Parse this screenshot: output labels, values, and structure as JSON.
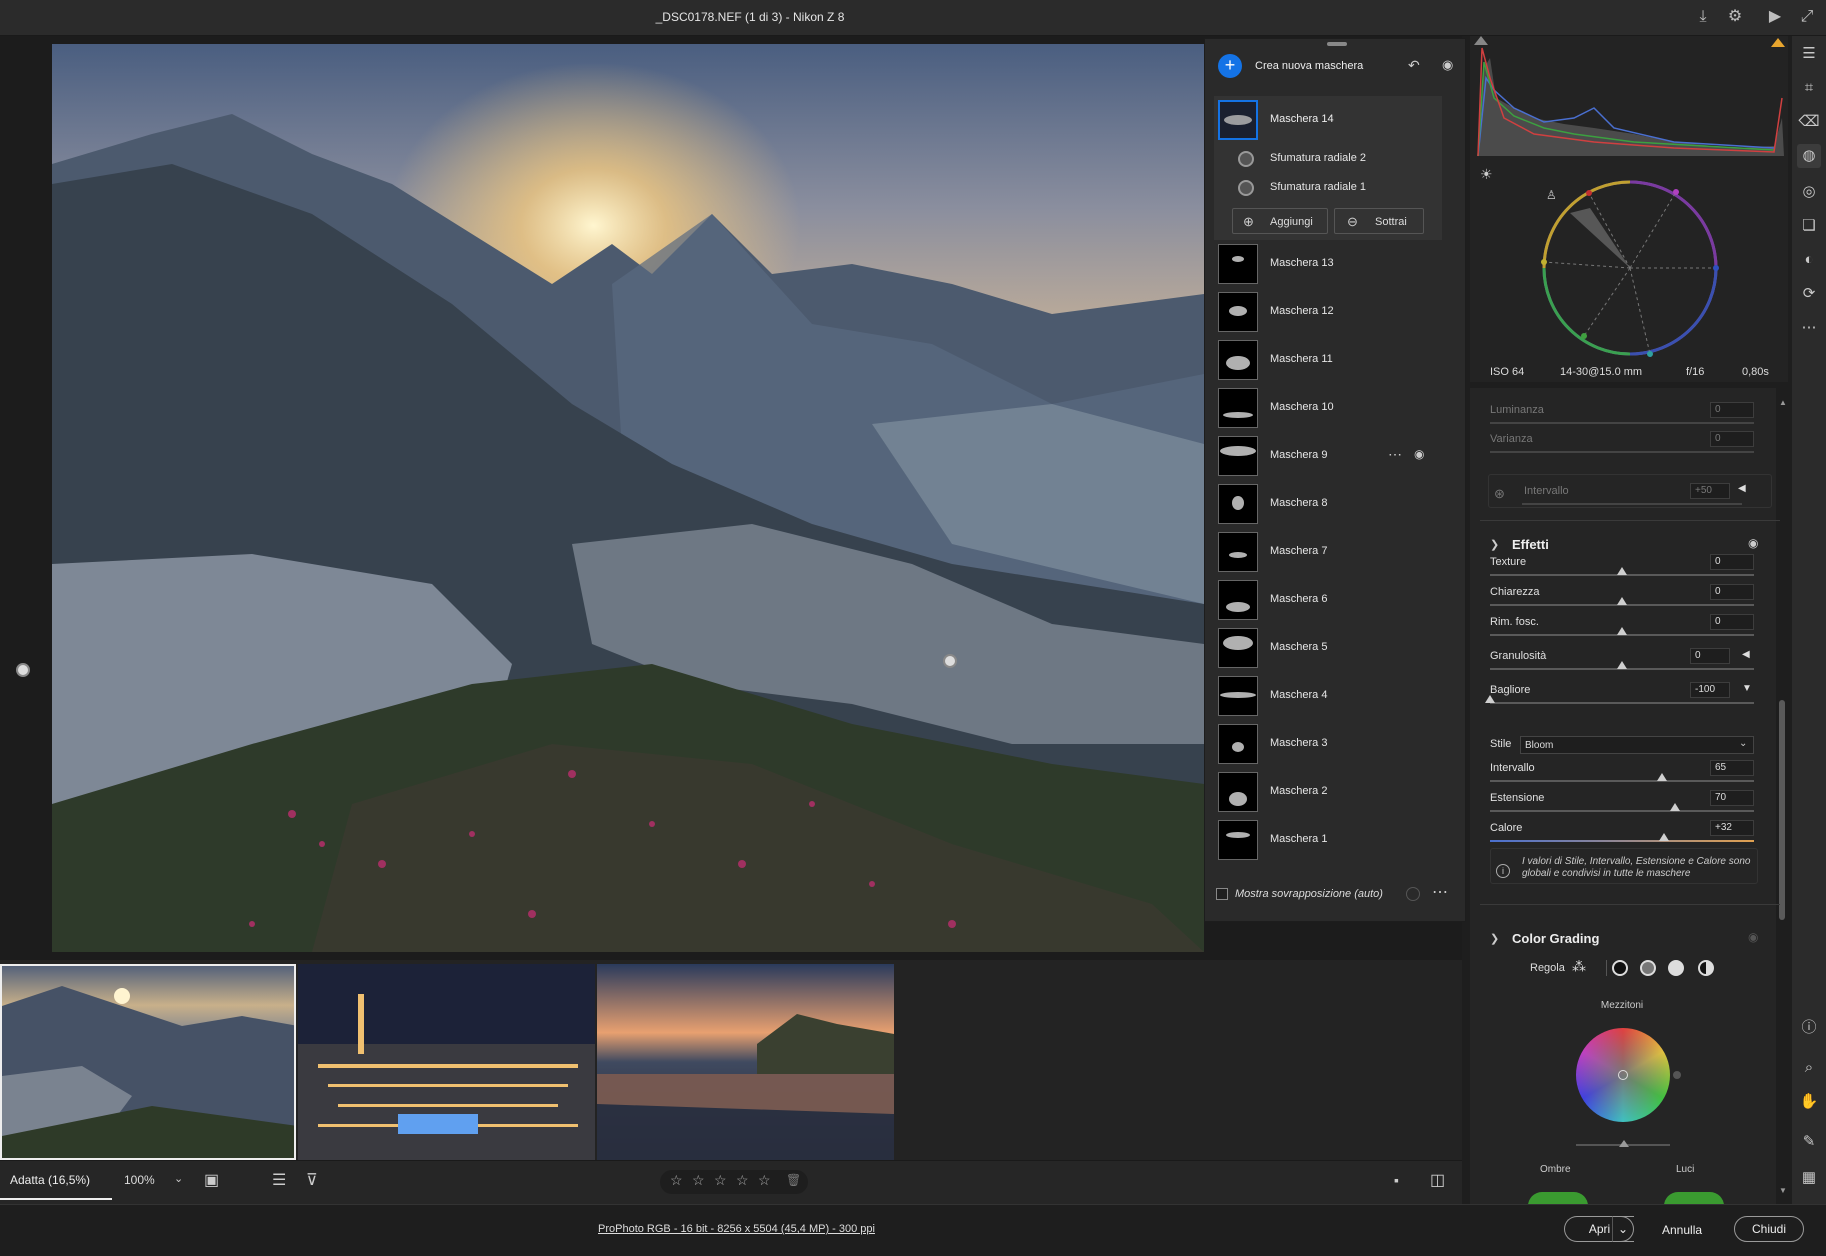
{
  "titlebar": {
    "title": "_DSC0178.NEF (1 di 3)  -  Nikon Z 8"
  },
  "masks": {
    "create_label": "Crea nuova maschera",
    "active": {
      "name": "Maschera 14",
      "components": [
        "Sfumatura radiale 2",
        "Sfumatura radiale 1"
      ],
      "add_label": "Aggiungi",
      "subtract_label": "Sottrai"
    },
    "list": [
      "Maschera 13",
      "Maschera 12",
      "Maschera 11",
      "Maschera 10",
      "Maschera 9",
      "Maschera 8",
      "Maschera 7",
      "Maschera 6",
      "Maschera 5",
      "Maschera 4",
      "Maschera 3",
      "Maschera 2",
      "Maschera 1"
    ],
    "overlay_label": "Mostra sovrapposizione (auto)"
  },
  "exif": {
    "iso": "ISO 64",
    "lens": "14-30@15.0 mm",
    "aperture": "f/16",
    "shutter": "0,80s"
  },
  "range": {
    "luminanza_label": "Luminanza",
    "luminanza_value": "0",
    "varianza_label": "Varianza",
    "varianza_value": "0",
    "intervallo_label": "Intervallo",
    "intervallo_value": "+50"
  },
  "effetti": {
    "title": "Effetti",
    "sliders": [
      {
        "label": "Texture",
        "value": "0",
        "pos": 0.5
      },
      {
        "label": "Chiarezza",
        "value": "0",
        "pos": 0.5
      },
      {
        "label": "Rim. fosc.",
        "value": "0",
        "pos": 0.5
      },
      {
        "label": "Granulosità",
        "value": "0",
        "pos": 0.5
      },
      {
        "label": "Bagliore",
        "value": "-100",
        "pos": 0.0
      }
    ],
    "stile_label": "Stile",
    "stile_value": "Bloom",
    "sub": [
      {
        "label": "Intervallo",
        "value": "65",
        "pos": 0.65
      },
      {
        "label": "Estensione",
        "value": "70",
        "pos": 0.7
      },
      {
        "label": "Calore",
        "value": "+32",
        "pos": 0.66
      }
    ],
    "note": "I valori di Stile, Intervallo, Estensione e Calore sono globali e condivisi in tutte le maschere"
  },
  "color_grading": {
    "title": "Color Grading",
    "regola_label": "Regola",
    "mezzitoni_label": "Mezzitoni",
    "ombre_label": "Ombre",
    "luci_label": "Luci"
  },
  "bottombar": {
    "zoom_fit": "Adatta (16,5%)",
    "zoom_pct": "100%"
  },
  "footer": {
    "info": "ProPhoto RGB - 16 bit - 8256 x 5504 (45,4 MP) - 300 ppi",
    "open_label": "Apri",
    "cancel_label": "Annulla",
    "close_label": "Chiudi"
  },
  "colors": {
    "accent": "#1473e6",
    "bg": "#1e1e1e",
    "panel": "#252525"
  }
}
